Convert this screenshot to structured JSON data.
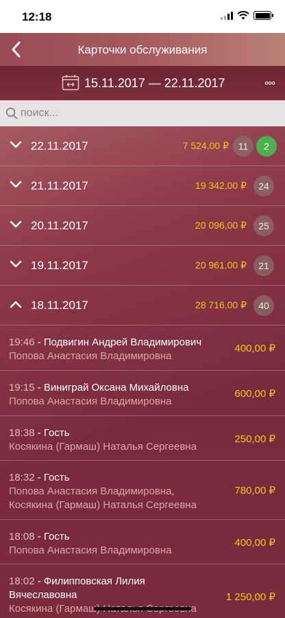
{
  "status": {
    "time": "12:18"
  },
  "nav": {
    "title": "Карточки обслуживания"
  },
  "period": {
    "range": "15.11.2017 — 22.11.2017"
  },
  "search": {
    "placeholder": "поиск..."
  },
  "days": [
    {
      "date": "22.11.2017",
      "amount": "7 524,00 ₽",
      "count": "11",
      "extra": "2",
      "expanded": false
    },
    {
      "date": "21.11.2017",
      "amount": "19 342,00 ₽",
      "count": "24",
      "expanded": false
    },
    {
      "date": "20.11.2017",
      "amount": "20 096,00 ₽",
      "count": "25",
      "expanded": false
    },
    {
      "date": "19.11.2017",
      "amount": "20 961,00 ₽",
      "count": "21",
      "expanded": false
    },
    {
      "date": "18.11.2017",
      "amount": "28 716,00 ₽",
      "count": "40",
      "expanded": true
    }
  ],
  "transactions": [
    {
      "time": "19:46",
      "client": "Подвигин Андрей Владимирович",
      "staff": "Попова Анастасия Владимировна",
      "amount": "400,00 ₽"
    },
    {
      "time": "19:15",
      "client": "Виниграй Оксана Михайловна",
      "staff": "Попова Анастасия Владимировна",
      "amount": "600,00 ₽"
    },
    {
      "time": "18:38",
      "client": "Гость",
      "staff": "Косякина (Гармаш) Наталья Сергеевна",
      "amount": "250,00 ₽"
    },
    {
      "time": "18:32",
      "client": "Гость",
      "staff": "Попова Анастасия Владимировна, Косякина (Гармаш) Наталья Сергеевна",
      "amount": "780,00 ₽"
    },
    {
      "time": "18:08",
      "client": "Гость",
      "staff": "Попова Анастасия Владимировна",
      "amount": "400,00 ₽"
    },
    {
      "time": "18:02",
      "client": "Филипповская Лилия Вячеславовна",
      "staff": "Косякина (Гармаш) Наталья Сергеевна",
      "amount": "1 250,00 ₽"
    }
  ],
  "icons": {
    "back": "back-arrow-icon",
    "calendar": "calendar-range-icon",
    "more": "more-dots-icon",
    "search": "search-icon",
    "collapsed": "chevron-down-icon",
    "expanded": "chevron-up-icon"
  },
  "colors": {
    "amount": "#f5c518",
    "badge_green": "#4caf50",
    "background": "#7d2f3e"
  }
}
